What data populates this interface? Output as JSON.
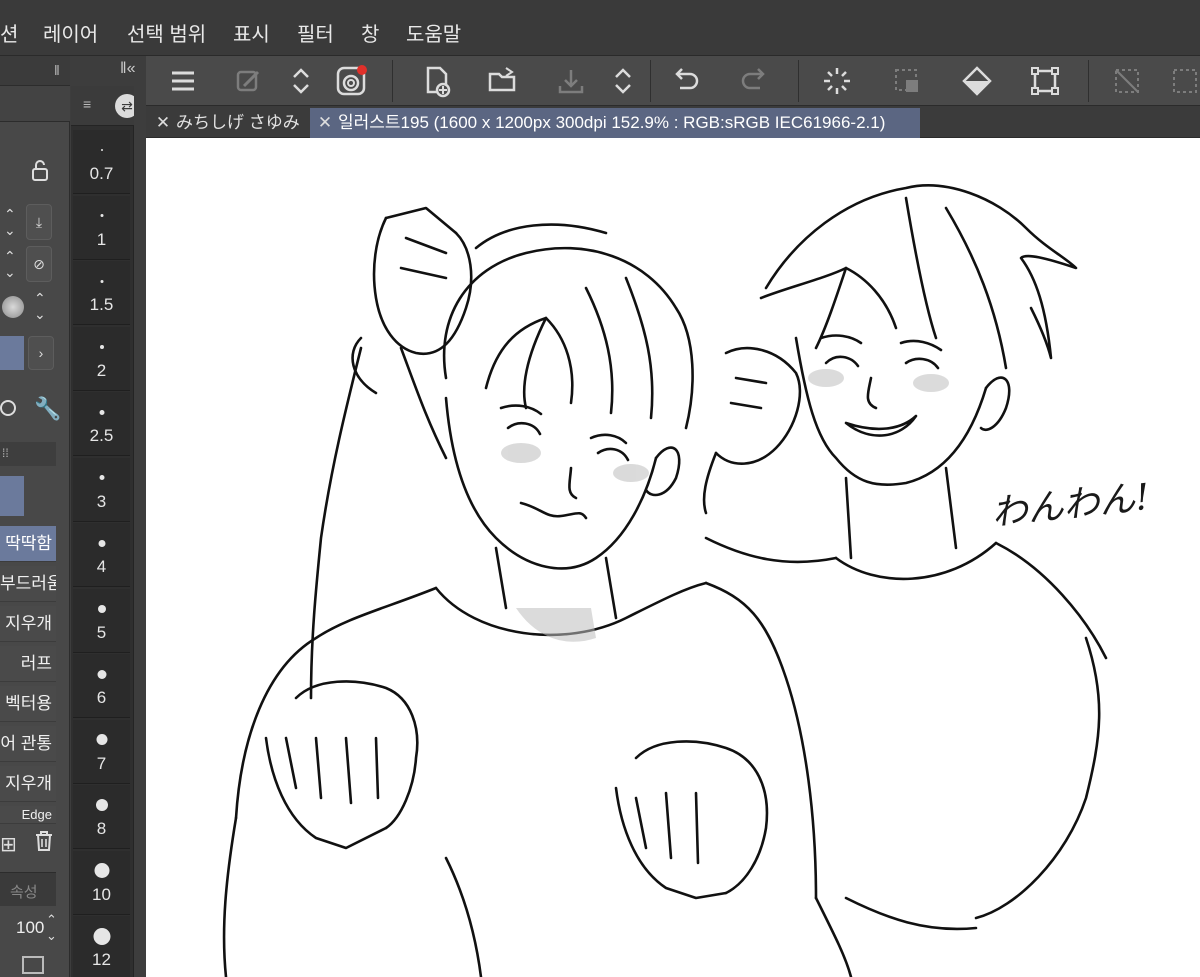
{
  "menubar": {
    "items": [
      "션",
      "레이어",
      "선택 범위",
      "표시",
      "필터",
      "창",
      "도움말"
    ]
  },
  "tabs": [
    {
      "label": "みちしげ  さゆみ"
    },
    {
      "label": "일러스트195 (1600 x 1200px 300dpi 152.9% : RGB:sRGB IEC61966-2.1)"
    }
  ],
  "brush_sizes": [
    "0.7",
    "1",
    "1.5",
    "2",
    "2.5",
    "3",
    "4",
    "5",
    "6",
    "7",
    "8",
    "10",
    "12"
  ],
  "subtool_items": [
    "딱딱함",
    "부드러움",
    "지우개",
    "러프",
    "벡터용",
    "어 관통",
    "지우개",
    "Edge"
  ],
  "left_panel": {
    "section_label": "속성",
    "opacity_value": "100"
  },
  "canvas_text": "わんわん!",
  "colors": {
    "accent_tab": "#5b6682",
    "accent_selected": "#6b7a9c",
    "toolbar_icon": "#dcdcdc",
    "red_dot": "#e0302a"
  }
}
